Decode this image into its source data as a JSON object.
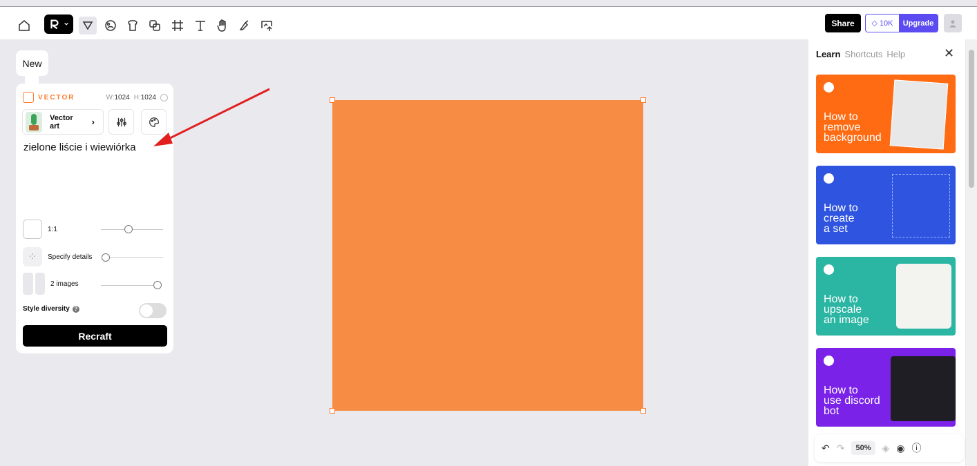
{
  "header": {
    "share_label": "Share",
    "credits": "10K",
    "upgrade_label": "Upgrade"
  },
  "left_panel": {
    "new_tab": "New",
    "model_label": "VECTOR",
    "width_label": "W:",
    "width_value": "1024",
    "height_label": "H:",
    "height_value": "1024",
    "style_name": "Vector art",
    "prompt": "zielone liście i wiewiórka",
    "aspect_ratio": "1:1",
    "details_label": "Specify details",
    "images_label": "2 images",
    "diversity_label": "Style diversity",
    "diversity_on": false,
    "recraft_label": "Recraft"
  },
  "canvas": {
    "fill_color": "#f78d45"
  },
  "right_panel": {
    "tabs": [
      "Learn",
      "Shortcuts",
      "Help"
    ],
    "cards": [
      {
        "title": "How to\nremove\nbackground",
        "color": "#ff6b12"
      },
      {
        "title": "How to\ncreate\na set",
        "color": "#2f55e0"
      },
      {
        "title": "How to\nupscale\nan image",
        "color": "#2bb5a3"
      },
      {
        "title": "How to\nuse discord\nbot",
        "color": "#7a22e8"
      }
    ]
  },
  "bottom_bar": {
    "zoom": "50%"
  },
  "colors": {
    "accent": "#ff7b2e",
    "brand_purple": "#5b4bf0"
  }
}
